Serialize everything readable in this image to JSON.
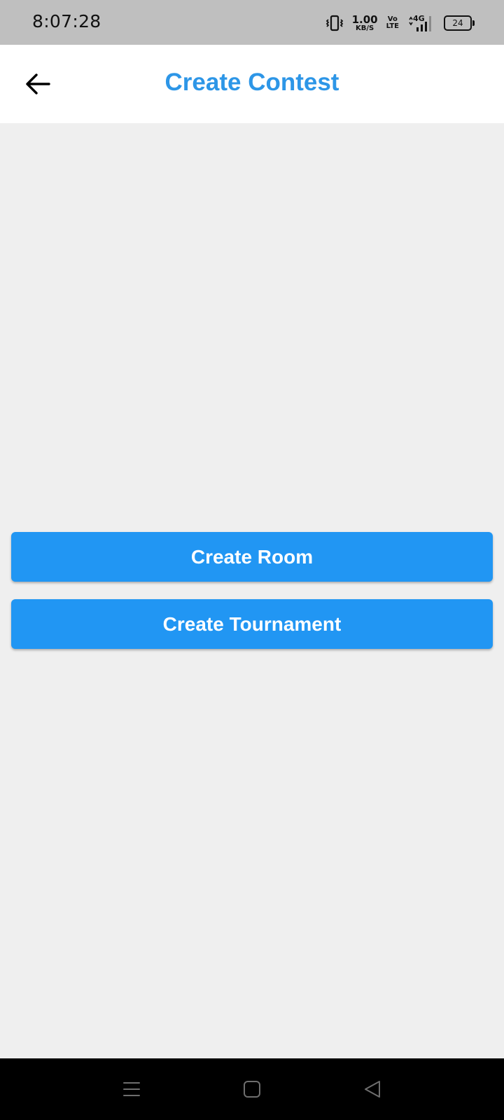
{
  "status_bar": {
    "time": "8:07:28",
    "net_speed_value": "1.00",
    "net_speed_unit": "KB/S",
    "volte_top": "Vo",
    "volte_bottom": "LTE",
    "network_type": "4G",
    "battery_level": "24",
    "icons": [
      "vibrate-icon",
      "signal-icon",
      "battery-icon"
    ]
  },
  "app_bar": {
    "title": "Create Contest",
    "title_color": "#2d96e7",
    "back_icon": "arrow-left-icon"
  },
  "actions": {
    "create_room_label": "Create Room",
    "create_tournament_label": "Create Tournament",
    "button_color": "#2196f3"
  },
  "nav_bar": {
    "icons": [
      "menu-icon",
      "home-icon",
      "back-triangle-icon"
    ]
  }
}
